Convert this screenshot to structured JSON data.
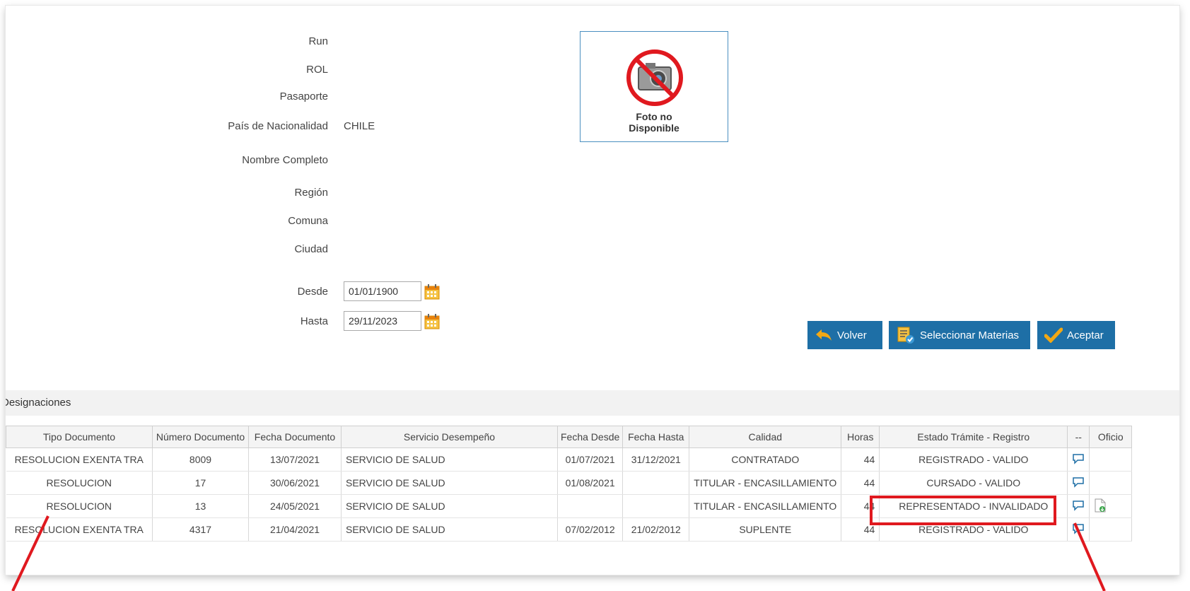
{
  "person": {
    "labels": {
      "run": "Run",
      "rol": "ROL",
      "pasaporte": "Pasaporte",
      "pais": "País de Nacionalidad",
      "nombre": "Nombre Completo",
      "region": "Región",
      "comuna": "Comuna",
      "ciudad": "Ciudad",
      "desde": "Desde",
      "hasta": "Hasta"
    },
    "values": {
      "pais": "CHILE"
    },
    "desde": "01/01/1900",
    "hasta": "29/11/2023"
  },
  "photo": {
    "line1": "Foto no",
    "line2": "Disponible"
  },
  "buttons": {
    "volver": "Volver",
    "seleccionar": "Seleccionar Materias",
    "aceptar": "Aceptar"
  },
  "section": {
    "title": "Designaciones"
  },
  "table": {
    "headers": [
      "Tipo Documento",
      "Número Documento",
      "Fecha Documento",
      "Servicio Desempeño",
      "Fecha Desde",
      "Fecha Hasta",
      "Calidad",
      "Horas",
      "Estado Trámite - Registro",
      "--",
      "Oficio"
    ],
    "rows": [
      {
        "tipo": "RESOLUCION EXENTA TRA",
        "numero": "8009",
        "fecha_doc": "13/07/2021",
        "servicio": "SERVICIO DE SALUD",
        "desde": "01/07/2021",
        "hasta": "31/12/2021",
        "calidad": "CONTRATADO",
        "horas": "44",
        "estado": "REGISTRADO - VALIDO"
      },
      {
        "tipo": "RESOLUCION",
        "numero": "17",
        "fecha_doc": "30/06/2021",
        "servicio": "SERVICIO DE SALUD",
        "desde": "01/08/2021",
        "hasta": "",
        "calidad": "TITULAR - ENCASILLAMIENTO",
        "horas": "44",
        "estado": "CURSADO - VALIDO"
      },
      {
        "tipo": "RESOLUCION",
        "numero": "13",
        "fecha_doc": "24/05/2021",
        "servicio": "SERVICIO DE SALUD",
        "desde": "",
        "hasta": "",
        "calidad": "TITULAR - ENCASILLAMIENTO",
        "horas": "44",
        "estado": "REPRESENTADO - INVALIDADO"
      },
      {
        "tipo": "RESOLUCION EXENTA TRA",
        "numero": "4317",
        "fecha_doc": "21/04/2021",
        "servicio": "SERVICIO DE SALUD",
        "desde": "07/02/2012",
        "hasta": "21/02/2012",
        "calidad": "SUPLENTE",
        "horas": "44",
        "estado": "REGISTRADO - VALIDO"
      }
    ]
  },
  "colors": {
    "accent": "#1e6fa6",
    "highlight": "#e0191f"
  }
}
